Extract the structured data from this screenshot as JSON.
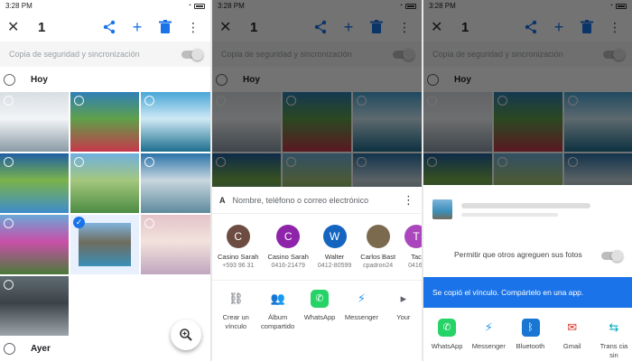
{
  "status_bar": {
    "time": "3:28 PM"
  },
  "toolbar": {
    "selected_count": "1"
  },
  "backup": {
    "label": "Copia de seguridad y sincronización",
    "enabled": false
  },
  "sections": {
    "today": "Hoy",
    "yesterday": "Ayer"
  },
  "photos": [
    {
      "name": "snowy-forest",
      "colors": [
        "#d9dee3",
        "#8a9aa6",
        "#f2f4f6"
      ],
      "selected": false
    },
    {
      "name": "red-river-valley",
      "colors": [
        "#2f7fb7",
        "#c6384a",
        "#5fa04a"
      ],
      "selected": false
    },
    {
      "name": "lake-mountains",
      "colors": [
        "#47a6d6",
        "#1d6e8e",
        "#cfe9f5"
      ],
      "selected": false
    },
    {
      "name": "cliff-coast",
      "colors": [
        "#1f5fa3",
        "#3d8ccc",
        "#7bb34a"
      ],
      "selected": false
    },
    {
      "name": "alpine-valley",
      "colors": [
        "#6fb0df",
        "#4c8c43",
        "#a4c77e"
      ],
      "selected": false
    },
    {
      "name": "mountain-reflection",
      "colors": [
        "#2a73a9",
        "#5e8a9c",
        "#c8d7df"
      ],
      "selected": false
    },
    {
      "name": "flower-meadow",
      "colors": [
        "#6aa7d8",
        "#4a7a3a",
        "#c94fa8"
      ],
      "selected": false
    },
    {
      "name": "moraine-lake",
      "colors": [
        "#7fb4dc",
        "#3a8fb8",
        "#6f6c5e"
      ],
      "selected": true
    },
    {
      "name": "pastel-sunset",
      "colors": [
        "#e3c3c9",
        "#c0a6bf",
        "#f2e2dc"
      ],
      "selected": false
    },
    {
      "name": "screenshot-thumb",
      "colors": [
        "#5f6b72",
        "#9ca5aa",
        "#3c4348"
      ],
      "selected": false
    }
  ],
  "share_sheet": {
    "search_prefix": "A",
    "search_placeholder": "Nombre, teléfono o correo electrónico",
    "contacts": [
      {
        "initial": "C",
        "name": "Casino Sarah",
        "detail": "+593 96 31",
        "color": "#6d4c41"
      },
      {
        "initial": "C",
        "name": "Casino Sarah",
        "detail": "0416-21479",
        "color": "#8e24aa"
      },
      {
        "initial": "W",
        "name": "Walter",
        "detail": "0412-80599",
        "color": "#1565c0"
      },
      {
        "initial": "",
        "name": "Carlos Bast",
        "detail": "cpadron24",
        "color": "#7c6a4f"
      },
      {
        "initial": "T",
        "name": "Tac",
        "detail": "0416-",
        "color": "#ab47bc"
      }
    ],
    "apps": [
      {
        "icon": "link-icon",
        "label": "Crear un vínculo",
        "color": "#5f6368"
      },
      {
        "icon": "shared-album-icon",
        "label": "Álbum compartido",
        "color": "#5f6368"
      },
      {
        "icon": "whatsapp-icon",
        "label": "WhatsApp",
        "color": "#25d366"
      },
      {
        "icon": "messenger-icon",
        "label": "Messenger",
        "color": "#2196f3"
      },
      {
        "icon": "more-icon",
        "label": "Your",
        "color": "#5f6368"
      }
    ]
  },
  "link_sheet": {
    "allow_label": "Permitir que otros agreguen sus fotos",
    "snackbar": "Se copió el vínculo. Compártelo en una app.",
    "apps": [
      {
        "icon": "whatsapp-icon",
        "label": "WhatsApp",
        "color": "#25d366"
      },
      {
        "icon": "messenger-icon",
        "label": "Messenger",
        "color": "#2196f3"
      },
      {
        "icon": "bluetooth-icon",
        "label": "Bluetooth",
        "color": "#1976d2"
      },
      {
        "icon": "gmail-icon",
        "label": "Gmail",
        "color": "#d93025"
      },
      {
        "icon": "transfer-icon",
        "label": "Trans cia sin",
        "color": "#00acc1"
      }
    ]
  }
}
